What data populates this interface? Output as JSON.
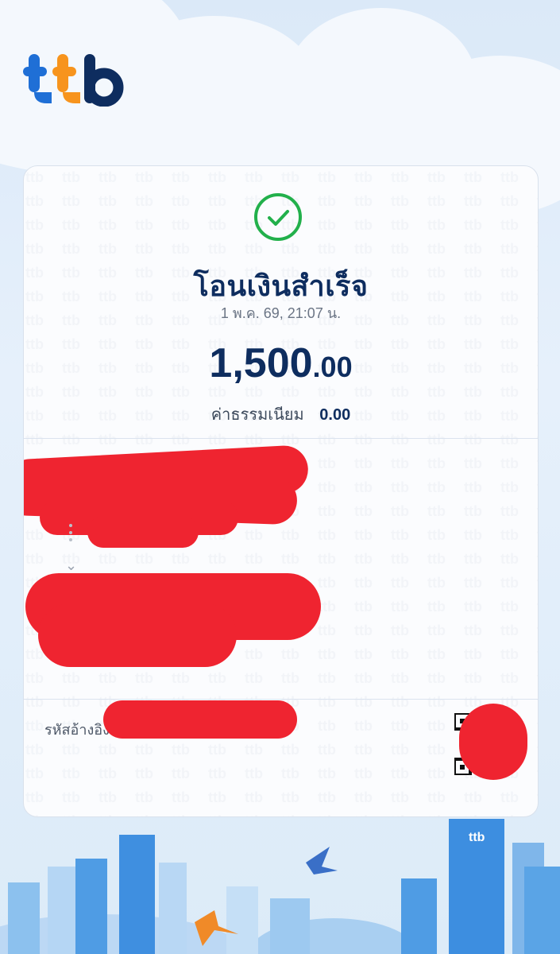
{
  "brand": {
    "logo_text": "ttb"
  },
  "receipt": {
    "status_title": "โอนเงินสำเร็จ",
    "datetime": "1 พ.ค. 69, 21:07 น.",
    "amount_integer": "1,500",
    "amount_decimal": ".00",
    "fee_label": "ค่าธรรมเนียม",
    "fee_value": "0.00",
    "reference_label": "รหัสอ้างอิง"
  },
  "footer": {
    "building_logo": "ttb"
  },
  "colors": {
    "navy": "#0e2d5f",
    "success": "#22b04b",
    "redaction": "#ef2430",
    "orange": "#f7941d",
    "blue": "#1f6fd6"
  }
}
